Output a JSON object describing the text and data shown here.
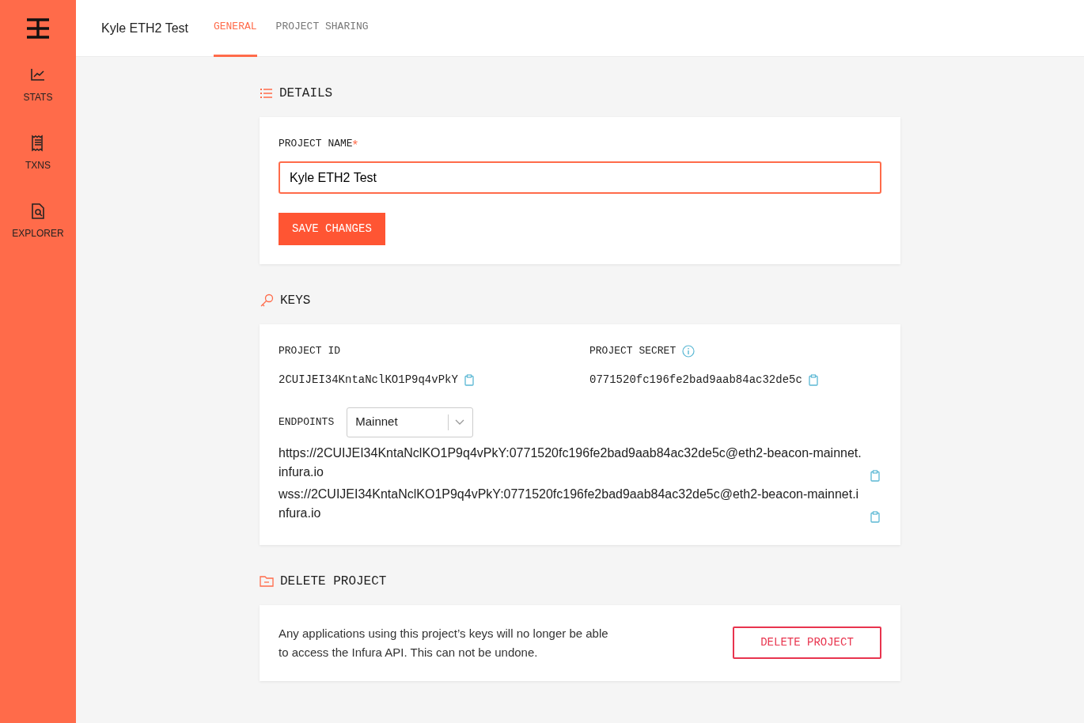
{
  "sidebar": {
    "items": [
      {
        "label": "STATS"
      },
      {
        "label": "TXNS"
      },
      {
        "label": "EXPLORER"
      }
    ]
  },
  "header": {
    "project_title": "Kyle ETH2 Test",
    "tabs": [
      {
        "label": "GENERAL",
        "selected": true
      },
      {
        "label": "PROJECT SHARING",
        "selected": false
      }
    ]
  },
  "details": {
    "heading": "DETAILS",
    "field_label": "PROJECT NAME",
    "required_mark": "*",
    "value": "Kyle ETH2 Test",
    "button": "SAVE CHANGES"
  },
  "keys": {
    "heading": "KEYS",
    "project_id_label": "PROJECT ID",
    "project_id": "2CUIJEI34KntaNclKO1P9q4vPkY",
    "project_secret_label": "PROJECT SECRET",
    "project_secret": "0771520fc196fe2bad9aab84ac32de5c",
    "endpoints_label": "ENDPOINTS",
    "network": "Mainnet",
    "endpoints": [
      "https://2CUIJEI34KntaNclKO1P9q4vPkY:0771520fc196fe2bad9aab84ac32de5c@eth2-beacon-mainnet.infura.io",
      "wss://2CUIJEI34KntaNclKO1P9q4vPkY:0771520fc196fe2bad9aab84ac32de5c@eth2-beacon-mainnet.infura.io"
    ]
  },
  "delete": {
    "heading": "DELETE PROJECT",
    "text": "Any applications using this project’s keys will no longer be able to access the Infura API. This can not be undone.",
    "button": "DELETE PROJECT"
  }
}
